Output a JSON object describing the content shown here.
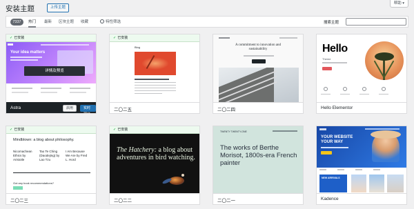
{
  "header": {
    "title": "安装主题",
    "upload_label": "上传主题",
    "help_label": "帮助 ▾"
  },
  "filter": {
    "count": "7337",
    "tabs": [
      "热门",
      "最新",
      "区块主题",
      "收藏"
    ],
    "feature_filter_label": "特性筛选",
    "search_label": "搜索主题"
  },
  "installed_label": "已安装",
  "themes": [
    {
      "name": "Astra",
      "installed": true,
      "hero_title": "Your idea matters",
      "hero_button": "详情及预览",
      "activate_label": "启用",
      "live_preview_label": "实时预览"
    },
    {
      "name": "二〇二五",
      "installed": true,
      "mini_title": "Blog"
    },
    {
      "name": "二〇二四",
      "installed": false,
      "headline": "A commitment to innovation and sustainability"
    },
    {
      "name": "Hello Elementor",
      "installed": false,
      "hero_title": "Hello",
      "hero_sub": "Theme"
    },
    {
      "name": "二〇二三",
      "installed": true,
      "headline": "Mindblown: a blog about philosophy.",
      "posts": [
        "Nicomachean Ethics by Aristotle",
        "Tao Te Ching (Daodejing) by Lao Tzu",
        "I Am Because We Are by Fred L. Hord"
      ],
      "cta": "Got any book recommendations?"
    },
    {
      "name": "二〇二二",
      "installed": true,
      "headline_em": "The Hatchery:",
      "headline_rest": " a blog about adventures in bird watching."
    },
    {
      "name": "二〇二一",
      "installed": false,
      "headline": "The works of Berthe Morisot, 1800s-era French painter",
      "mini_title": "TWENTY TWENTY-ONE"
    },
    {
      "name": "Kadence",
      "installed": false,
      "hero_title": "YOUR WEBSITE YOUR WAY",
      "section_title": "NEW ARRIVALS"
    }
  ],
  "colors": {
    "accent": "#2271b1",
    "installed_bg": "#edfaef",
    "astra_grad_a": "#a78bfa",
    "astra_grad_b": "#f0abfc",
    "tt5_red": "#e0492e",
    "tt1_bg": "#d1e4dd",
    "kadence_blue": "#1e5fc8"
  }
}
